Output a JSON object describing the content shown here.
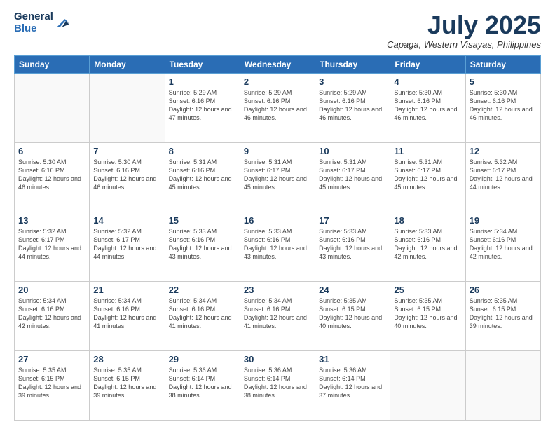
{
  "header": {
    "logo_line1": "General",
    "logo_line2": "Blue",
    "month_year": "July 2025",
    "location": "Capaga, Western Visayas, Philippines"
  },
  "weekdays": [
    "Sunday",
    "Monday",
    "Tuesday",
    "Wednesday",
    "Thursday",
    "Friday",
    "Saturday"
  ],
  "weeks": [
    [
      {
        "day": "",
        "sunrise": "",
        "sunset": "",
        "daylight": ""
      },
      {
        "day": "",
        "sunrise": "",
        "sunset": "",
        "daylight": ""
      },
      {
        "day": "1",
        "sunrise": "Sunrise: 5:29 AM",
        "sunset": "Sunset: 6:16 PM",
        "daylight": "Daylight: 12 hours and 47 minutes."
      },
      {
        "day": "2",
        "sunrise": "Sunrise: 5:29 AM",
        "sunset": "Sunset: 6:16 PM",
        "daylight": "Daylight: 12 hours and 46 minutes."
      },
      {
        "day": "3",
        "sunrise": "Sunrise: 5:29 AM",
        "sunset": "Sunset: 6:16 PM",
        "daylight": "Daylight: 12 hours and 46 minutes."
      },
      {
        "day": "4",
        "sunrise": "Sunrise: 5:30 AM",
        "sunset": "Sunset: 6:16 PM",
        "daylight": "Daylight: 12 hours and 46 minutes."
      },
      {
        "day": "5",
        "sunrise": "Sunrise: 5:30 AM",
        "sunset": "Sunset: 6:16 PM",
        "daylight": "Daylight: 12 hours and 46 minutes."
      }
    ],
    [
      {
        "day": "6",
        "sunrise": "Sunrise: 5:30 AM",
        "sunset": "Sunset: 6:16 PM",
        "daylight": "Daylight: 12 hours and 46 minutes."
      },
      {
        "day": "7",
        "sunrise": "Sunrise: 5:30 AM",
        "sunset": "Sunset: 6:16 PM",
        "daylight": "Daylight: 12 hours and 46 minutes."
      },
      {
        "day": "8",
        "sunrise": "Sunrise: 5:31 AM",
        "sunset": "Sunset: 6:16 PM",
        "daylight": "Daylight: 12 hours and 45 minutes."
      },
      {
        "day": "9",
        "sunrise": "Sunrise: 5:31 AM",
        "sunset": "Sunset: 6:17 PM",
        "daylight": "Daylight: 12 hours and 45 minutes."
      },
      {
        "day": "10",
        "sunrise": "Sunrise: 5:31 AM",
        "sunset": "Sunset: 6:17 PM",
        "daylight": "Daylight: 12 hours and 45 minutes."
      },
      {
        "day": "11",
        "sunrise": "Sunrise: 5:31 AM",
        "sunset": "Sunset: 6:17 PM",
        "daylight": "Daylight: 12 hours and 45 minutes."
      },
      {
        "day": "12",
        "sunrise": "Sunrise: 5:32 AM",
        "sunset": "Sunset: 6:17 PM",
        "daylight": "Daylight: 12 hours and 44 minutes."
      }
    ],
    [
      {
        "day": "13",
        "sunrise": "Sunrise: 5:32 AM",
        "sunset": "Sunset: 6:17 PM",
        "daylight": "Daylight: 12 hours and 44 minutes."
      },
      {
        "day": "14",
        "sunrise": "Sunrise: 5:32 AM",
        "sunset": "Sunset: 6:17 PM",
        "daylight": "Daylight: 12 hours and 44 minutes."
      },
      {
        "day": "15",
        "sunrise": "Sunrise: 5:33 AM",
        "sunset": "Sunset: 6:16 PM",
        "daylight": "Daylight: 12 hours and 43 minutes."
      },
      {
        "day": "16",
        "sunrise": "Sunrise: 5:33 AM",
        "sunset": "Sunset: 6:16 PM",
        "daylight": "Daylight: 12 hours and 43 minutes."
      },
      {
        "day": "17",
        "sunrise": "Sunrise: 5:33 AM",
        "sunset": "Sunset: 6:16 PM",
        "daylight": "Daylight: 12 hours and 43 minutes."
      },
      {
        "day": "18",
        "sunrise": "Sunrise: 5:33 AM",
        "sunset": "Sunset: 6:16 PM",
        "daylight": "Daylight: 12 hours and 42 minutes."
      },
      {
        "day": "19",
        "sunrise": "Sunrise: 5:34 AM",
        "sunset": "Sunset: 6:16 PM",
        "daylight": "Daylight: 12 hours and 42 minutes."
      }
    ],
    [
      {
        "day": "20",
        "sunrise": "Sunrise: 5:34 AM",
        "sunset": "Sunset: 6:16 PM",
        "daylight": "Daylight: 12 hours and 42 minutes."
      },
      {
        "day": "21",
        "sunrise": "Sunrise: 5:34 AM",
        "sunset": "Sunset: 6:16 PM",
        "daylight": "Daylight: 12 hours and 41 minutes."
      },
      {
        "day": "22",
        "sunrise": "Sunrise: 5:34 AM",
        "sunset": "Sunset: 6:16 PM",
        "daylight": "Daylight: 12 hours and 41 minutes."
      },
      {
        "day": "23",
        "sunrise": "Sunrise: 5:34 AM",
        "sunset": "Sunset: 6:16 PM",
        "daylight": "Daylight: 12 hours and 41 minutes."
      },
      {
        "day": "24",
        "sunrise": "Sunrise: 5:35 AM",
        "sunset": "Sunset: 6:15 PM",
        "daylight": "Daylight: 12 hours and 40 minutes."
      },
      {
        "day": "25",
        "sunrise": "Sunrise: 5:35 AM",
        "sunset": "Sunset: 6:15 PM",
        "daylight": "Daylight: 12 hours and 40 minutes."
      },
      {
        "day": "26",
        "sunrise": "Sunrise: 5:35 AM",
        "sunset": "Sunset: 6:15 PM",
        "daylight": "Daylight: 12 hours and 39 minutes."
      }
    ],
    [
      {
        "day": "27",
        "sunrise": "Sunrise: 5:35 AM",
        "sunset": "Sunset: 6:15 PM",
        "daylight": "Daylight: 12 hours and 39 minutes."
      },
      {
        "day": "28",
        "sunrise": "Sunrise: 5:35 AM",
        "sunset": "Sunset: 6:15 PM",
        "daylight": "Daylight: 12 hours and 39 minutes."
      },
      {
        "day": "29",
        "sunrise": "Sunrise: 5:36 AM",
        "sunset": "Sunset: 6:14 PM",
        "daylight": "Daylight: 12 hours and 38 minutes."
      },
      {
        "day": "30",
        "sunrise": "Sunrise: 5:36 AM",
        "sunset": "Sunset: 6:14 PM",
        "daylight": "Daylight: 12 hours and 38 minutes."
      },
      {
        "day": "31",
        "sunrise": "Sunrise: 5:36 AM",
        "sunset": "Sunset: 6:14 PM",
        "daylight": "Daylight: 12 hours and 37 minutes."
      },
      {
        "day": "",
        "sunrise": "",
        "sunset": "",
        "daylight": ""
      },
      {
        "day": "",
        "sunrise": "",
        "sunset": "",
        "daylight": ""
      }
    ]
  ]
}
